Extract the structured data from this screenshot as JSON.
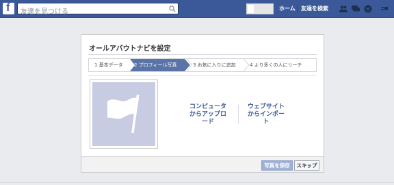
{
  "topbar": {
    "logo": "f",
    "search_placeholder": "友達を見つける",
    "home_label": "ホーム",
    "find_friends_label": "友達を検索",
    "icons": [
      "friend-requests-icon",
      "messages-icon",
      "notifications-icon",
      "settings-icon"
    ]
  },
  "dialog": {
    "title": "オールアバウトナビを設定",
    "steps": [
      {
        "label": "1 基本データ",
        "active": false
      },
      {
        "label": "2 プロフィール写真",
        "active": true
      },
      {
        "label": "3 お気に入りに追加",
        "active": false
      },
      {
        "label": "4 より多くの人にリーチ",
        "active": false
      }
    ],
    "upload_option": [
      "コンピュータ",
      "からアップロ",
      "ード"
    ],
    "import_option": [
      "ウェブサイト",
      "からインポー",
      "ト"
    ],
    "save_button": "写真を保存",
    "skip_button": "スキップ"
  },
  "colors": {
    "topbar": "#3b5998",
    "active_step": "#5b74a8",
    "placeholder_bg": "#c8cce3"
  }
}
